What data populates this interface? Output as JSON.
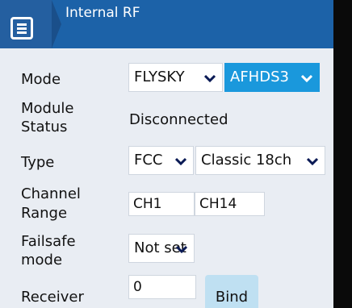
{
  "header": {
    "title": "Internal RF",
    "menu_icon": "menu-icon"
  },
  "colors": {
    "header_bg": "#1c62a8",
    "accent": "#1a98dc",
    "content_bg": "#e9edf3"
  },
  "mode": {
    "label": "Mode",
    "protocol": "FLYSKY",
    "subtype": "AFHDS3"
  },
  "module_status": {
    "label_line1": "Module",
    "label_line2": "Status",
    "value": "Disconnected"
  },
  "type": {
    "label": "Type",
    "region": "FCC",
    "channels": "Classic 18ch"
  },
  "channel_range": {
    "label_line1": "Channel",
    "label_line2": "Range",
    "start": "CH1",
    "end": "CH14"
  },
  "failsafe": {
    "label_line1": "Failsafe",
    "label_line2": "mode",
    "value": "Not set"
  },
  "receiver": {
    "label": "Receiver",
    "number": "0",
    "bind_label": "Bind"
  }
}
